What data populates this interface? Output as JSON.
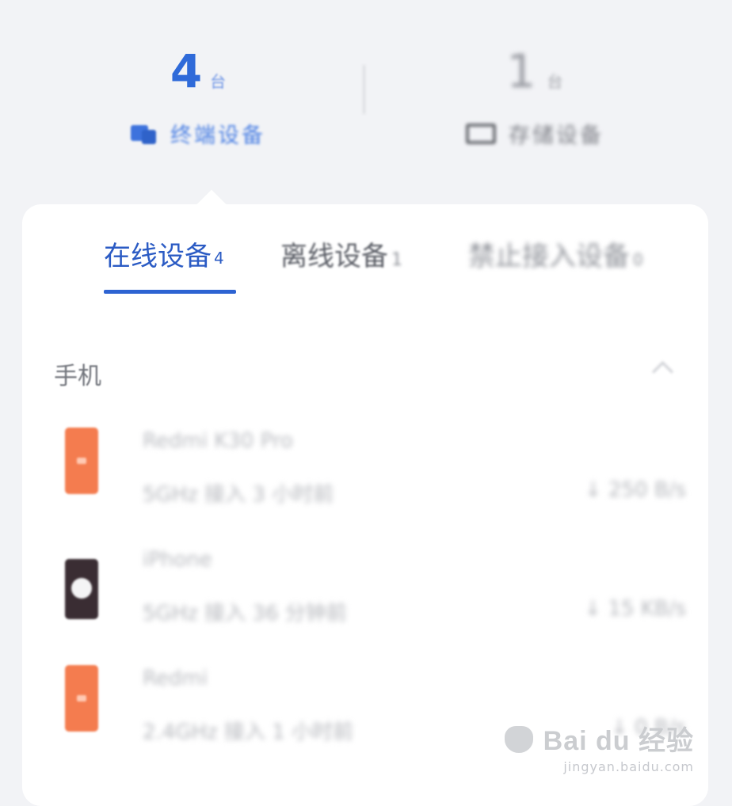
{
  "stats": {
    "devices": {
      "count": "4",
      "unit": "台",
      "label": "终端设备"
    },
    "storage": {
      "count": "1",
      "unit": "台",
      "label": "存储设备"
    }
  },
  "tabs": [
    {
      "label": "在线设备",
      "badge": "4",
      "active": true
    },
    {
      "label": "离线设备",
      "badge": "1",
      "active": false
    },
    {
      "label": "禁止接入设备",
      "badge": "0",
      "active": false
    }
  ],
  "section": {
    "title": "手机"
  },
  "devices": [
    {
      "name": "Redmi K30 Pro",
      "meta": "5GHz 接入 3 小时前",
      "speed": "↓ 250 B/s",
      "icon": "phone-orange-icon"
    },
    {
      "name": "iPhone",
      "meta": "5GHz 接入 36 分钟前",
      "speed": "↓ 15 KB/s",
      "icon": "phone-dark-icon"
    },
    {
      "name": "Redmi",
      "meta": "2.4GHz 接入 1 小时前",
      "speed": "↓ 0 B/s",
      "icon": "phone-orange-icon"
    }
  ],
  "watermark": {
    "logo_text": "Bai du 经验",
    "url": "jingyan.baidu.com"
  },
  "colors": {
    "accent": "#2d63d2",
    "background": "#f2f3f6",
    "card": "#ffffff",
    "phone_orange": "#f47c4f"
  }
}
